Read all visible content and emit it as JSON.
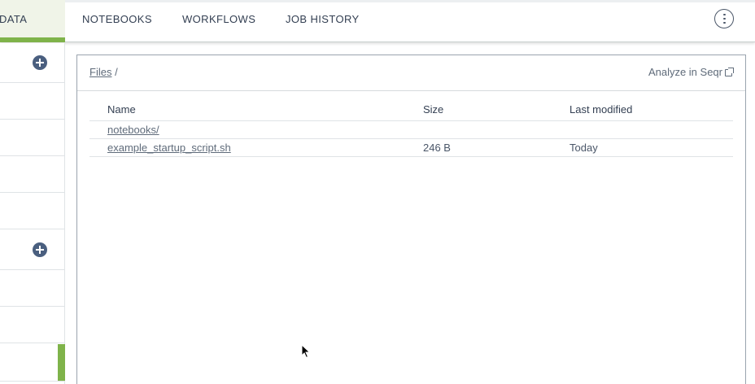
{
  "nav": {
    "tabs": [
      {
        "label": "DATA",
        "active": true
      },
      {
        "label": "NOTEBOOKS"
      },
      {
        "label": "WORKFLOWS"
      },
      {
        "label": "JOB HISTORY"
      }
    ],
    "menu_icon": "kebab-vertical-icon",
    "active_color": "#7fb34a"
  },
  "sidebar": {
    "add_icon": "plus-circle-icon",
    "selected_color": "#7fb34a"
  },
  "panel": {
    "breadcrumb": {
      "root": "Files",
      "separator": "/"
    },
    "analyze_label": "Analyze in Seqr",
    "analyze_icon": "external-link-icon",
    "columns": {
      "name": "Name",
      "size": "Size",
      "modified": "Last modified"
    },
    "rows": [
      {
        "name": "notebooks/",
        "size": "",
        "modified": ""
      },
      {
        "name": "example_startup_script.sh",
        "size": "246 B",
        "modified": "Today"
      }
    ]
  }
}
